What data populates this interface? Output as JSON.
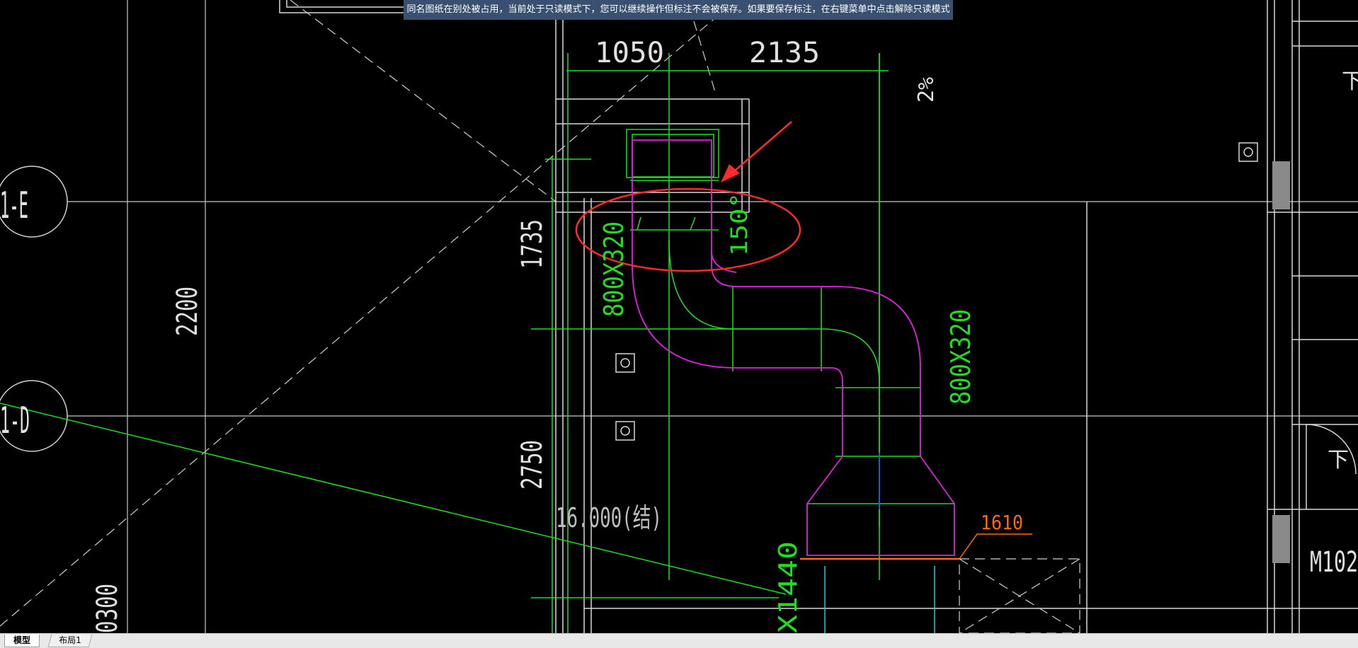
{
  "banner": {
    "message": "同名图纸在别处被占用，当前处于只读模式下，您可以继续操作但标注不会被保存。如果要保存标注，在右键菜单中点击解除只读模式"
  },
  "tabs": [
    {
      "label": "模型"
    },
    {
      "label": "布局1"
    }
  ],
  "drawing": {
    "dim_1050": "1050",
    "dim_2135": "2135",
    "dim_1735": "1735",
    "dim_2200": "2200",
    "dim_2750": "2750",
    "dim_0300": "0300",
    "slope": "2%",
    "axis_e": "1-E",
    "axis_d": "1-D",
    "duct_size_1": "800X320",
    "duct_size_2": "800X320",
    "angle": "150°",
    "elevation": "16.000(结)",
    "label_1610": "1610",
    "label_1440": "X1440",
    "label_down_1": "下",
    "label_down_2": "下",
    "door": "M102"
  },
  "colors": {
    "background": "#000000",
    "banner": "#3a5070",
    "white_line": "#d8d8d8",
    "green": "#22dd22",
    "magenta": "#dd22dd",
    "red_annotation": "#ff2a2a",
    "orange": "#ff6a10"
  }
}
